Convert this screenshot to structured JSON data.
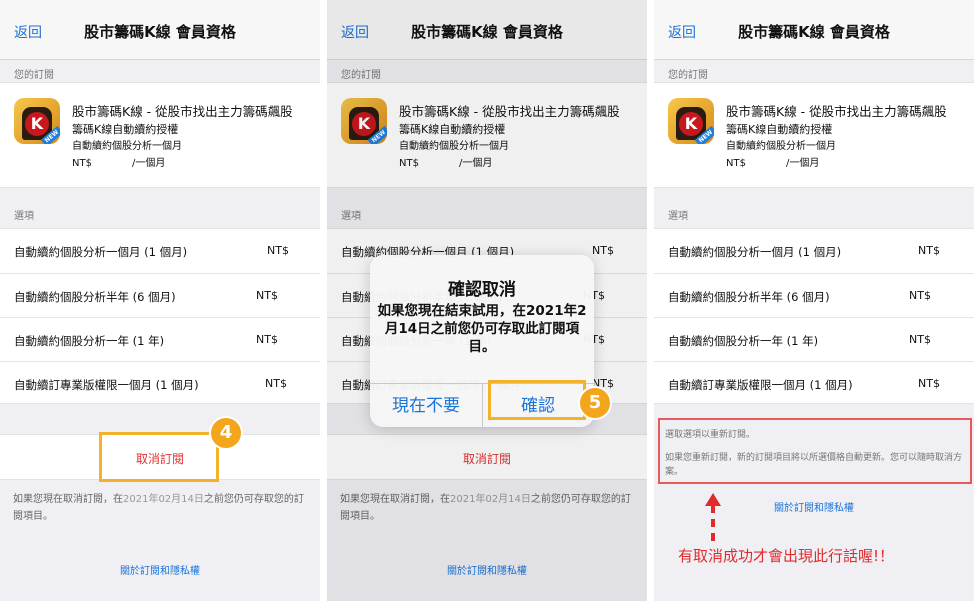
{
  "common": {
    "back_label": "返回",
    "nav_title": "股市籌碼K線 會員資格",
    "your_subscription_header": "您的訂閱",
    "app_icon_letter": "K",
    "app_icon_tag": "NEW",
    "subscription": {
      "title": "股市籌碼K線 - 從股市找出主力籌碼飆股",
      "plan": "籌碼K線自動續約授權",
      "detail": "自動續約個股分析一個月",
      "price_prefix": "NT$",
      "period": "/一個月"
    },
    "options_header": "選項",
    "options": [
      {
        "name": "自動續約個股分析一個月 (1 個月)",
        "price": "NT$"
      },
      {
        "name": "自動續約個股分析半年 (6 個月)",
        "price": "NT$"
      },
      {
        "name": "自動續約個股分析一年 (1 年)",
        "price": "NT$"
      },
      {
        "name": "自動續訂專業版權限一個月 (1 個月)",
        "price": "NT$"
      }
    ],
    "cancel_label": "取消訂閱",
    "cancel_note_prefix": "如果您現在取消訂閱，在",
    "cancel_note_date": "2021年02月14日",
    "cancel_note_suffix": "之前您仍可存取您的訂閱項目。",
    "privacy_label": "關於訂閱和隱私權"
  },
  "step_badges": {
    "step4": "4",
    "step5": "5"
  },
  "alert": {
    "title": "確認取消",
    "message": "如果您現在結束試用，在2021年2月14日之前您仍可存取此訂閱項目。",
    "not_now": "現在不要",
    "confirm": "確認"
  },
  "resubscribe": {
    "line1": "選取選項以重新訂閱。",
    "line2": "如果您重新訂閱，新的訂閱項目將以所選價格自動更新。您可以隨時取消方案。"
  },
  "annotation": {
    "callout": "有取消成功才會出現此行話喔!！",
    "highlight_color": "#f3b12c",
    "callout_color": "#e02b2b"
  },
  "colors": {
    "link_blue": "#1a73d9",
    "cancel_red": "#e53030"
  }
}
